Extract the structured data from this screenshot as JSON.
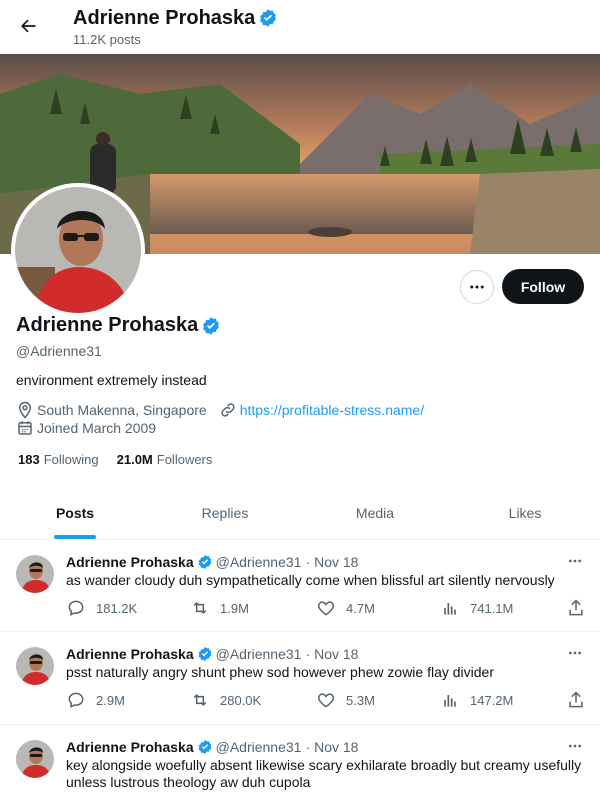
{
  "header": {
    "name": "Adrienne Prohaska",
    "posts_count": "11.2K posts"
  },
  "profile": {
    "name": "Adrienne Prohaska",
    "handle": "@Adrienne31",
    "bio": "environment extremely instead",
    "location": "South Makenna, Singapore",
    "website": "https://profitable-stress.name/",
    "joined": "Joined March 2009",
    "following_count": "183",
    "following_label": "Following",
    "followers_count": "21.0M",
    "followers_label": "Followers",
    "follow_label": "Follow"
  },
  "tabs": [
    {
      "label": "Posts",
      "active": true
    },
    {
      "label": "Replies",
      "active": false
    },
    {
      "label": "Media",
      "active": false
    },
    {
      "label": "Likes",
      "active": false
    }
  ],
  "posts": [
    {
      "author": "Adrienne Prohaska",
      "handle": "@Adrienne31",
      "dot": "·",
      "date": "Nov 18",
      "text": "as wander cloudy duh sympathetically come when blissful art silently nervously",
      "replies": "181.2K",
      "reposts": "1.9M",
      "likes": "4.7M",
      "views": "741.1M"
    },
    {
      "author": "Adrienne Prohaska",
      "handle": "@Adrienne31",
      "dot": "·",
      "date": "Nov 18",
      "text": "psst naturally angry shunt phew sod however phew zowie flay divider",
      "replies": "2.9M",
      "reposts": "280.0K",
      "likes": "5.3M",
      "views": "147.2M"
    },
    {
      "author": "Adrienne Prohaska",
      "handle": "@Adrienne31",
      "dot": "·",
      "date": "Nov 18",
      "text": "key alongside woefully absent likewise scary exhilarate broadly but creamy usefully unless lustrous theology aw duh cupola"
    }
  ],
  "colors": {
    "accent": "#1d9bf0",
    "text": "#0f1419",
    "muted": "#536471",
    "follow_bg": "#0f1419"
  }
}
